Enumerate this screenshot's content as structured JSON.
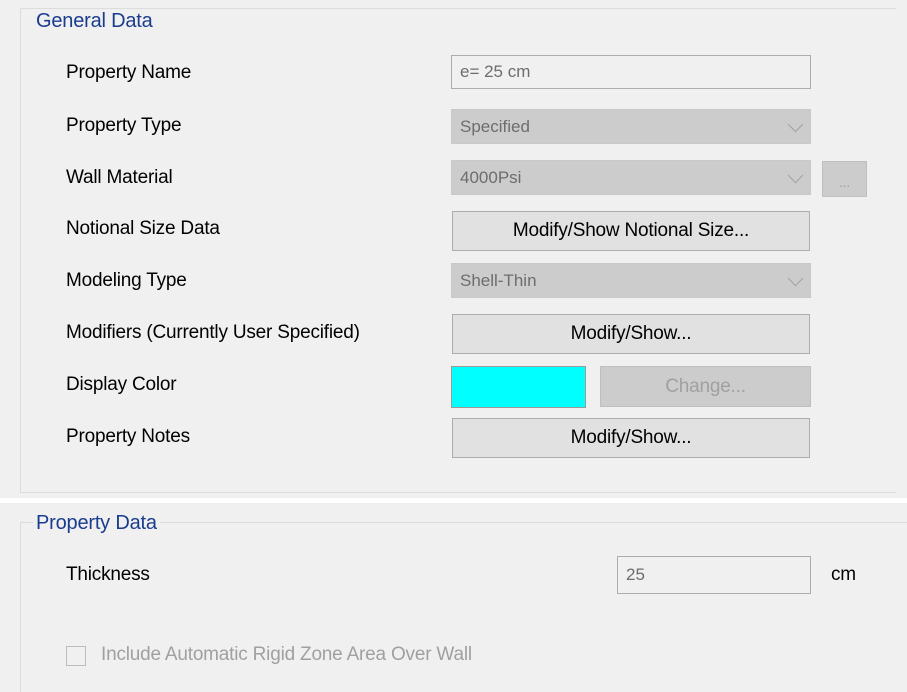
{
  "general_data": {
    "legend": "General Data",
    "rows": {
      "property_name": {
        "label": "Property Name",
        "value": "e= 25 cm"
      },
      "property_type": {
        "label": "Property Type",
        "value": "Specified"
      },
      "wall_material": {
        "label": "Wall Material",
        "value": "4000Psi",
        "browse_label": "..."
      },
      "notional_size": {
        "label": "Notional Size Data",
        "button": "Modify/Show Notional Size..."
      },
      "modeling_type": {
        "label": "Modeling Type",
        "value": "Shell-Thin"
      },
      "modifiers": {
        "label": "Modifiers (Currently User Specified)",
        "button": "Modify/Show..."
      },
      "display_color": {
        "label": "Display Color",
        "color": "#00ffff",
        "button": "Change..."
      },
      "property_notes": {
        "label": "Property Notes",
        "button": "Modify/Show..."
      }
    }
  },
  "property_data": {
    "legend": "Property Data",
    "thickness": {
      "label": "Thickness",
      "value": "25",
      "unit": "cm"
    },
    "rigid_zone": {
      "label": "Include Automatic Rigid Zone Area Over Wall",
      "checked": false
    }
  },
  "colors": {
    "legend_text": "#1a3c8f",
    "panel_bg": "#f0f0f0",
    "disabled_bg": "#cccccc",
    "swatch": "#00ffff"
  }
}
